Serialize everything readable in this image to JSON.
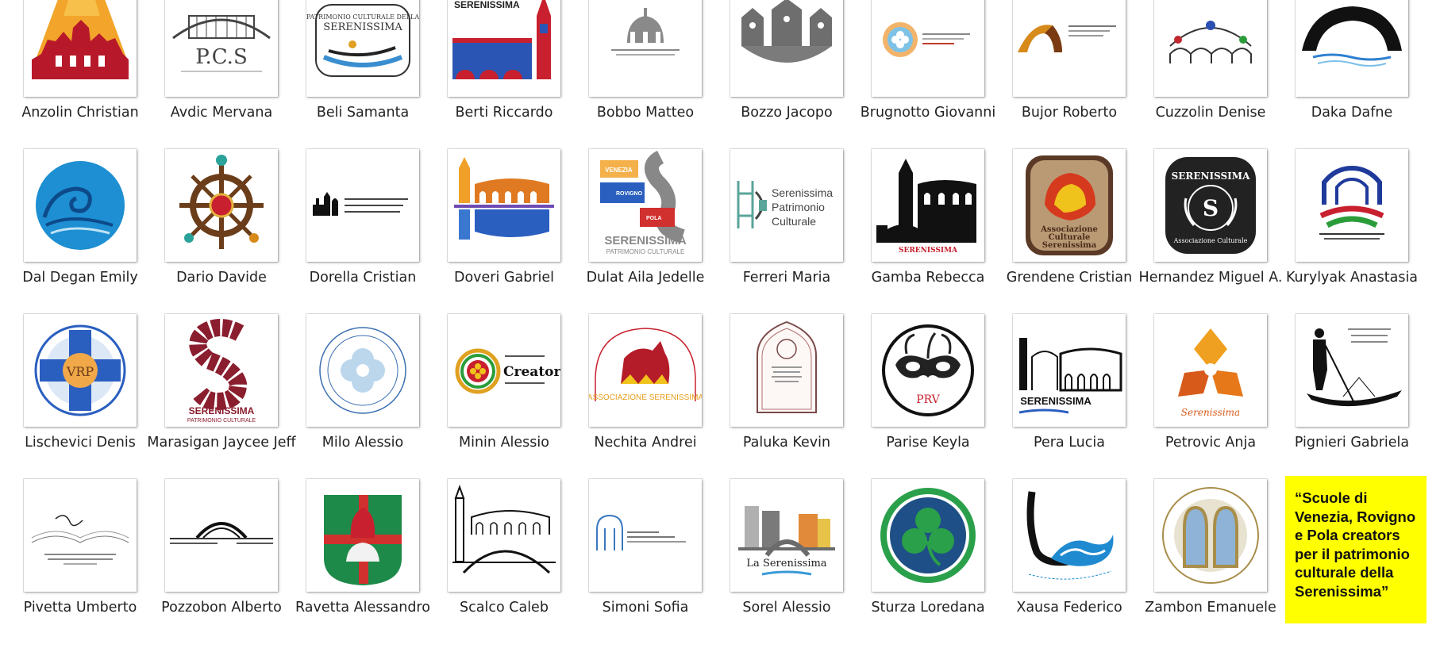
{
  "folder": {
    "items": [
      {
        "label": "Anzolin Christian",
        "icon": "arena-skyline-icon"
      },
      {
        "label": "Avdic Mervana",
        "icon": "pcs-bridge-icon"
      },
      {
        "label": "Beli Samanta",
        "icon": "gondola-emblem-icon"
      },
      {
        "label": "Berti Riccardo",
        "icon": "bell-tower-icon"
      },
      {
        "label": "Bobbo Matteo",
        "icon": "dome-icon"
      },
      {
        "label": "Bozzo Jacopo",
        "icon": "three-domes-icon"
      },
      {
        "label": "Brugnotto Giovanni",
        "icon": "quatrefoil-icon"
      },
      {
        "label": "Bujor Roberto",
        "icon": "arch-icon"
      },
      {
        "label": "Cuzzolin Denise",
        "icon": "arches-icon"
      },
      {
        "label": "Daka Dafne",
        "icon": "wave-arch-icon"
      },
      {
        "label": "Dal Degan Emily",
        "icon": "wave-circle-icon"
      },
      {
        "label": "Dario Davide",
        "icon": "ship-wheel-icon"
      },
      {
        "label": "Dorella Cristian",
        "icon": "skyline-text-icon"
      },
      {
        "label": "Doveri Gabriel",
        "icon": "colosseum-reflection-icon"
      },
      {
        "label": "Dulat Aila Jedelle",
        "icon": "map-blocks-icon"
      },
      {
        "label": "Ferreri Maria",
        "icon": "towers-text-icon"
      },
      {
        "label": "Gamba Rebecca",
        "icon": "city-skyline-icon"
      },
      {
        "label": "Grendene Cristian",
        "icon": "lion-badge-icon"
      },
      {
        "label": "Hernandez Miguel A.",
        "icon": "laurel-badge-icon"
      },
      {
        "label": "Kurylyak Anastasia",
        "icon": "tricolor-arch-icon"
      },
      {
        "label": "Lischevici Denis",
        "icon": "vrp-seal-icon"
      },
      {
        "label": "Marasigan Jaycee Jeff",
        "icon": "s-letter-icon"
      },
      {
        "label": "Milo Alessio",
        "icon": "quatrefoil-seal-icon"
      },
      {
        "label": "Minin Alessio",
        "icon": "creators-badge-icon"
      },
      {
        "label": "Nechita Andrei",
        "icon": "winged-lion-arch-icon"
      },
      {
        "label": "Paluka Kevin",
        "icon": "gothic-window-icon"
      },
      {
        "label": "Parise Keyla",
        "icon": "mask-icon"
      },
      {
        "label": "Pera Lucia",
        "icon": "monuments-icon"
      },
      {
        "label": "Petrovic Anja",
        "icon": "trefoil-icon"
      },
      {
        "label": "Pignieri Gabriela",
        "icon": "gondolier-icon"
      },
      {
        "label": "Pivetta Umberto",
        "icon": "open-book-icon"
      },
      {
        "label": "Pozzobon Alberto",
        "icon": "bridge-text-icon"
      },
      {
        "label": "Ravetta Alessandro",
        "icon": "shield-icon"
      },
      {
        "label": "Scalco Caleb",
        "icon": "sketch-bridge-icon"
      },
      {
        "label": "Simoni Sofia",
        "icon": "arch-window-icon"
      },
      {
        "label": "Sorel Alessio",
        "icon": "la-serenissima-icon"
      },
      {
        "label": "Sturza Loredana",
        "icon": "clover-icon"
      },
      {
        "label": "Xausa Federico",
        "icon": "gondola-wave-icon"
      },
      {
        "label": "Zambon Emanuele",
        "icon": "arched-seal-icon"
      }
    ]
  },
  "logo_text": {
    "pcs": "P.C.S",
    "beli_top": "PATRIMONIO CULTURALE DELLA",
    "beli_main": "SERENISSIMA",
    "berti": "SERENISSIMA",
    "dulat_main": "SERENISSIMA",
    "dulat_sub": "PATRIMONIO CULTURALE",
    "dulat_v": "VENEZIA",
    "dulat_r": "ROVIGNO",
    "dulat_p": "POLA",
    "ferreri": [
      "Serenissima",
      "Patrimonio",
      "Culturale"
    ],
    "gamba": "SERENISSIMA",
    "grendene": [
      "Associazione",
      "Culturale",
      "Serenissima"
    ],
    "hernandez_top": "SERENISSIMA",
    "hernandez_s": "S",
    "hernandez_bottom": "Associazione Culturale",
    "vrp": "VRP",
    "marasigan_main": "SERENISSIMA",
    "marasigan_sub": "PATRIMONIO CULTURALE",
    "minin": "Creators",
    "nechita": "ASSOCIAZIONE SERENISSIMA",
    "parise": "PRV",
    "pera": "SERENISSIMA",
    "petrovic": "Serenissima",
    "sorel": "La Serenissima"
  },
  "note": {
    "text": "“Scuole di Venezia, Rovigno e Pola creators per il patrimonio culturale della Serenissima”",
    "color": "#ffff00"
  }
}
